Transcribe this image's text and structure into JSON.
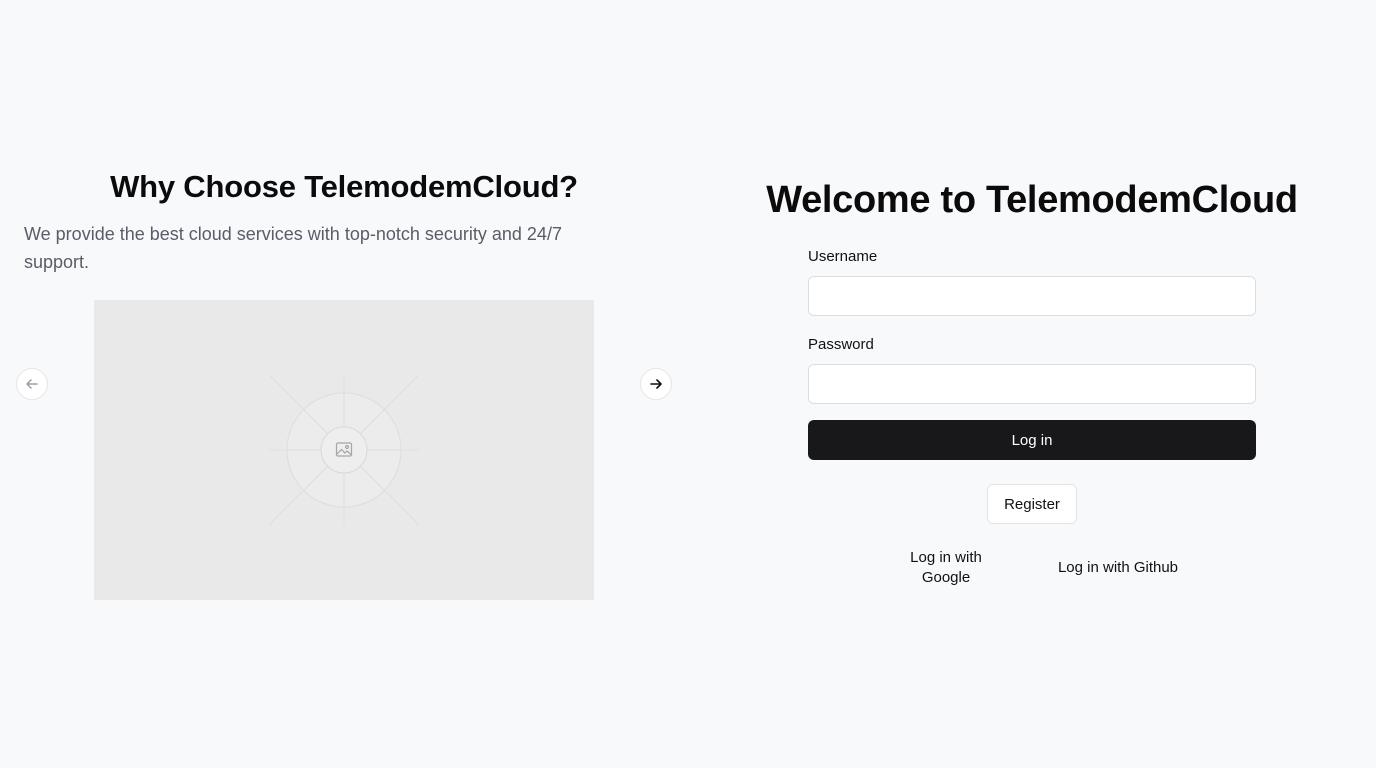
{
  "promo": {
    "title": "Why Choose TelemodemCloud?",
    "description": "We provide the best cloud services with top-notch security and 24/7 support.",
    "carousel": {
      "prev_icon": "arrow-left-icon",
      "next_icon": "arrow-right-icon",
      "image_icon": "image-placeholder-icon"
    }
  },
  "login": {
    "title": "Welcome to TelemodemCloud",
    "username_label": "Username",
    "username_value": "",
    "password_label": "Password",
    "password_value": "",
    "login_button": "Log in",
    "register_button": "Register",
    "google_link": "Log in with Google",
    "github_link": "Log in with Github"
  },
  "colors": {
    "background": "#f8f9fb",
    "primary_button": "#18181b",
    "muted_text": "#585d66",
    "placeholder_image": "#e9e9e9"
  }
}
